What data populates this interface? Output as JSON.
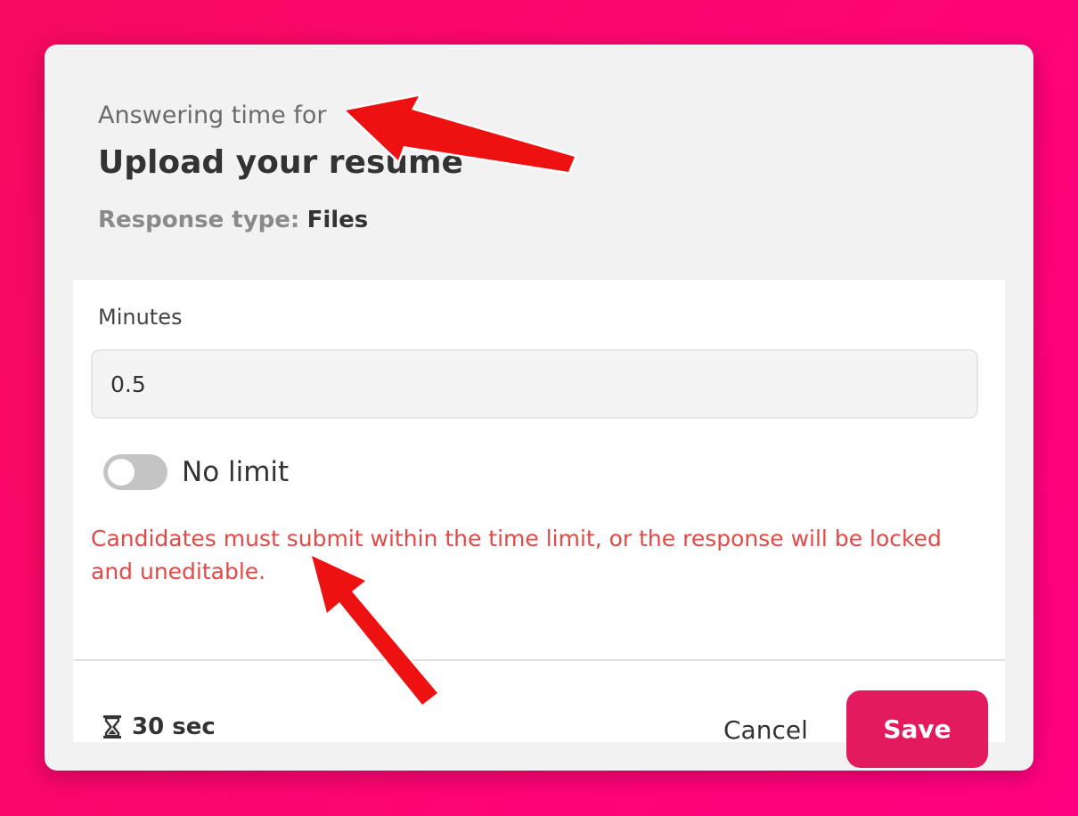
{
  "modal": {
    "subtitle": "Answering time for",
    "title": "Upload your resume",
    "response_type_label": "Response type:",
    "response_type_value": "Files"
  },
  "form": {
    "minutes_label": "Minutes",
    "minutes_value": "0.5",
    "no_limit_label": "No limit",
    "no_limit_enabled": false,
    "warning_text": "Candidates must submit within the time limit, or the response will be locked and uneditable."
  },
  "footer": {
    "timer_icon": "hourglass-icon",
    "timer_text": "30 sec",
    "cancel_label": "Cancel",
    "save_label": "Save"
  },
  "colors": {
    "background": "#fb0671",
    "save_button": "#e31b5e",
    "warning_text": "#e04a48",
    "annotation_arrow": "#ee1111"
  }
}
